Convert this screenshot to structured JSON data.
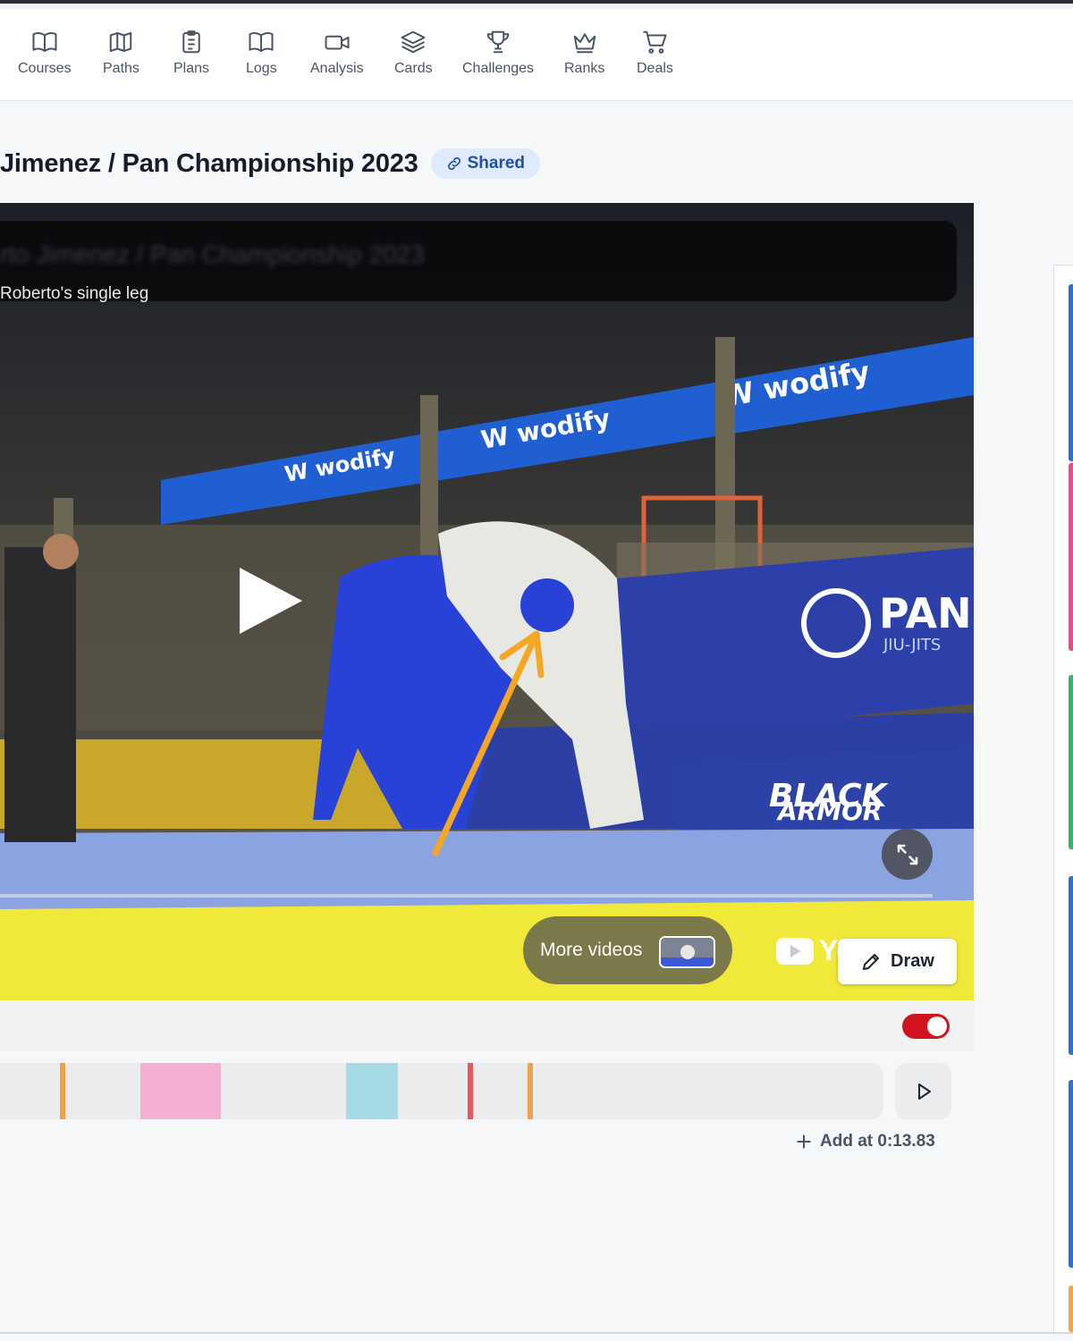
{
  "nav": {
    "items": [
      {
        "label": "Courses",
        "icon": "book-open-icon"
      },
      {
        "label": "Paths",
        "icon": "map-icon"
      },
      {
        "label": "Plans",
        "icon": "clipboard-list-icon"
      },
      {
        "label": "Logs",
        "icon": "book-open-icon"
      },
      {
        "label": "Analysis",
        "icon": "video-camera-icon"
      },
      {
        "label": "Cards",
        "icon": "layers-icon"
      },
      {
        "label": "Challenges",
        "icon": "trophy-icon"
      },
      {
        "label": "Ranks",
        "icon": "crown-icon"
      },
      {
        "label": "Deals",
        "icon": "shopping-cart-icon"
      }
    ]
  },
  "page": {
    "title": "Jimenez / Pan Championship 2023",
    "badge": "Shared"
  },
  "video": {
    "caption": "Roberto's single leg",
    "blurred_title": "rto Jimenez / Pan Championship 2023",
    "more_videos_label": "More videos",
    "youtube_text": "Yo",
    "draw_label": "Draw"
  },
  "timeline": {
    "add_label": "Add at 0:13.83",
    "markers": [
      {
        "kind": "tick",
        "color": "#f0a24a"
      },
      {
        "kind": "block",
        "color": "#f3b0d2"
      },
      {
        "kind": "block",
        "color": "#a6dbe6"
      },
      {
        "kind": "tick",
        "color": "#e8585a"
      },
      {
        "kind": "tick",
        "color": "#f0a24a"
      }
    ]
  },
  "toggle": {
    "on": true,
    "color": "#d1141d"
  },
  "colors": {
    "accent_blue": "#214fa6",
    "badge_bg": "#dfeafb",
    "annotation_arrow": "#f5a623"
  },
  "right_panel": {
    "accent_colors": [
      "#2f6fd6",
      "#e94b8a",
      "#3bb26a",
      "#2f6fd6",
      "#2f6fd6",
      "#f0a24a"
    ]
  }
}
